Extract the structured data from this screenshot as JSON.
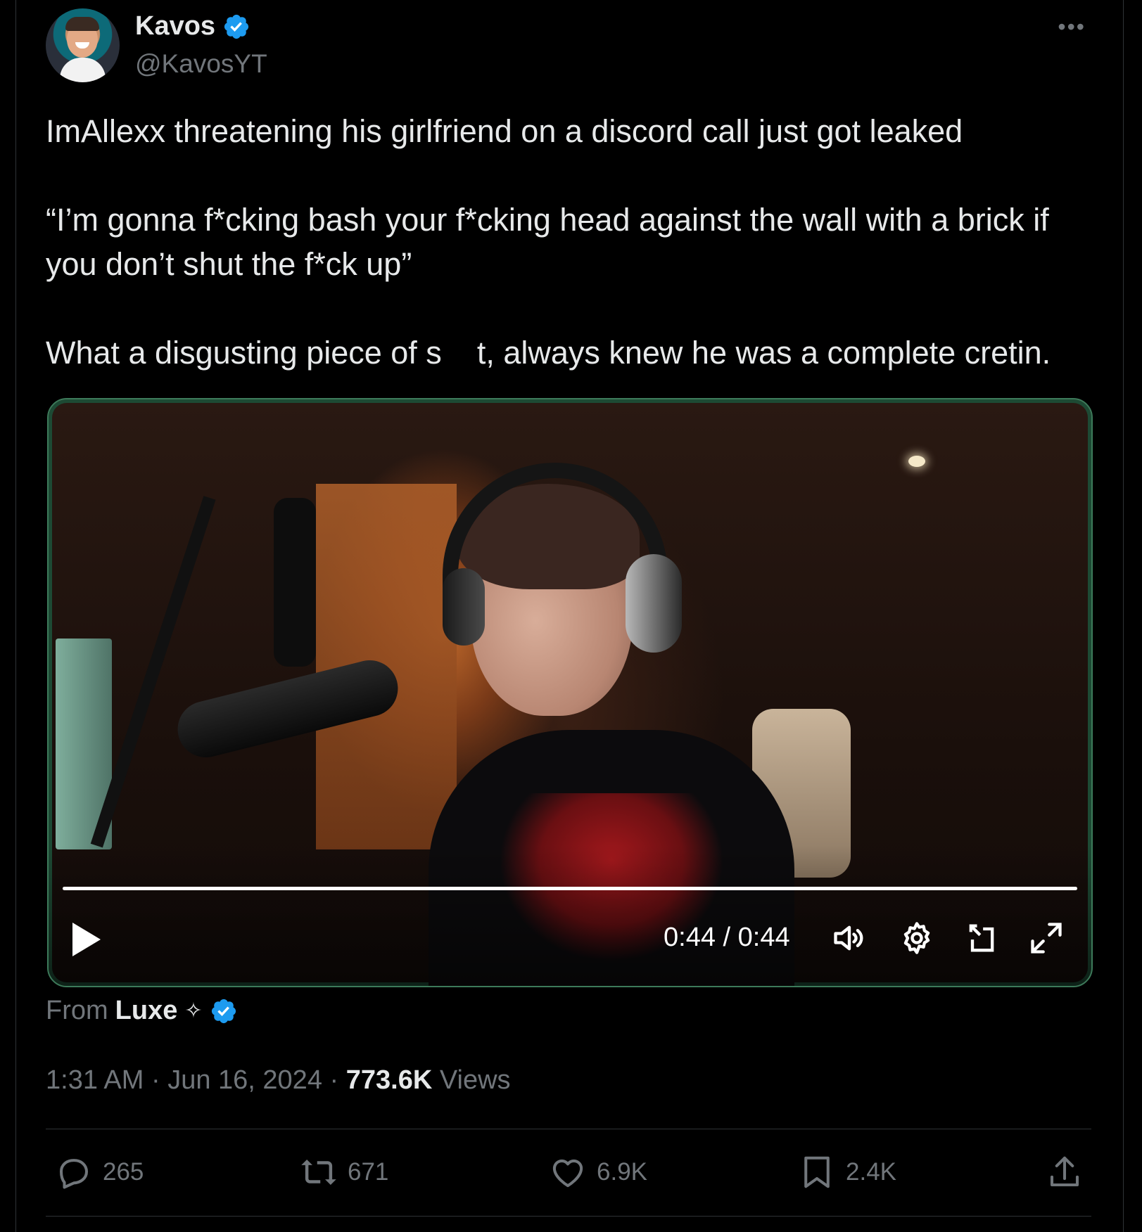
{
  "author": {
    "display_name": "Kavos",
    "handle": "@KavosYT",
    "verified_color": "#1d9bf0"
  },
  "more_icon": "•••",
  "tweet": {
    "line1": "ImAllexx threatening his girlfriend on a discord call just got leaked",
    "line2": "“I’m gonna f*cking bash your f*cking head against the wall with a brick if you don’t shut the f*ck up”",
    "line3": "What a disgusting piece of s    t, always knew he was a complete cretin."
  },
  "video": {
    "time": "0:44 / 0:44",
    "progress_fraction": 1.0,
    "controls": [
      "play-icon",
      "volume-icon",
      "settings-icon",
      "pip-icon",
      "fullscreen-icon"
    ]
  },
  "source": {
    "prefix": "From",
    "name": "Luxe",
    "sparkle": "✧"
  },
  "meta": {
    "time": "1:31 AM",
    "sep1": " · ",
    "date": "Jun 16, 2024",
    "sep2": " · ",
    "views_count": "773.6K",
    "views_label": " Views"
  },
  "actions": {
    "replies": "265",
    "reposts": "671",
    "likes": "6.9K",
    "bookmarks": "2.4K"
  },
  "colors": {
    "background": "#000000",
    "text": "#e7e9ea",
    "muted": "#71767b",
    "accent": "#1d9bf0"
  }
}
